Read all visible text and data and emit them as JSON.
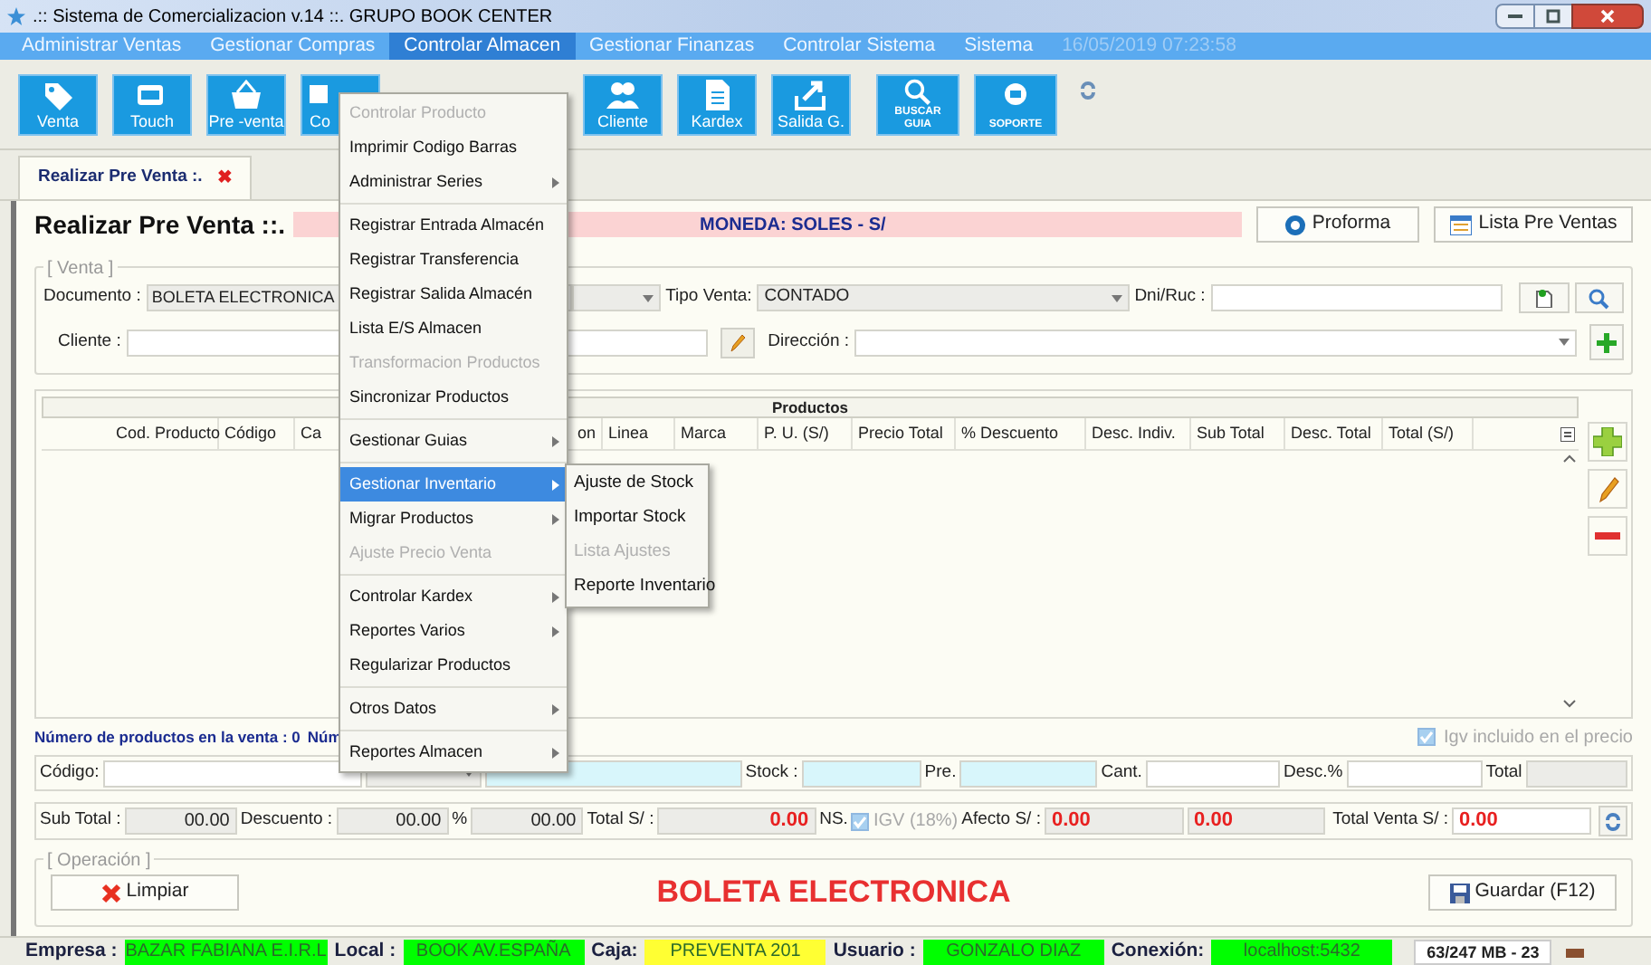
{
  "window": {
    "title": ".:: Sistema de Comercializacion v.14 ::.  GRUPO BOOK CENTER"
  },
  "menu_bar": {
    "items": [
      {
        "label": "Administrar Ventas",
        "selected": false
      },
      {
        "label": "Gestionar Compras",
        "selected": false
      },
      {
        "label": "Controlar Almacen",
        "selected": true
      },
      {
        "label": "Gestionar Finanzas",
        "selected": false
      },
      {
        "label": "Controlar Sistema",
        "selected": false
      },
      {
        "label": "Sistema",
        "selected": false
      }
    ],
    "datetime": "16/05/2019 07:23:58"
  },
  "toolbar": [
    {
      "label": "Venta",
      "kind": "tile"
    },
    {
      "label": "Touch",
      "kind": "tile"
    },
    {
      "label": "Pre -venta",
      "kind": "tile"
    },
    {
      "label": "Co",
      "kind": "tile"
    },
    {
      "label": "Cliente",
      "kind": "tile"
    },
    {
      "label": "Kardex",
      "kind": "tile"
    },
    {
      "label": "Salida G.",
      "kind": "tile"
    },
    {
      "label": "BUSCAR GUIA",
      "kind": "badge"
    },
    {
      "label": "SOPORTE",
      "kind": "badge"
    },
    {
      "kind": "refresh"
    }
  ],
  "tab": {
    "label": "Realizar Pre Venta :.",
    "close": "✖"
  },
  "heading": "Realizar Pre Venta ::.",
  "currency": "MONEDA: SOLES - S/",
  "header_buttons": [
    "Proforma",
    "Lista Pre Ventas"
  ],
  "venta": {
    "legend": "[ Venta ]",
    "documento_label": "Documento :",
    "documento": "BOLETA ELECTRONICA",
    "tipo_label": "Tipo Venta:",
    "tipo": "CONTADO",
    "dni_label": "Dni/Ruc :",
    "cliente_label": "Cliente :",
    "direccion_label": "Dirección :"
  },
  "products": {
    "title": "Productos",
    "columns": [
      "Cod. Producto",
      "Código",
      "Ca",
      "on",
      "Linea",
      "Marca",
      "P. U. (S/)",
      "Precio Total",
      "% Descuento",
      "Desc. Indiv.",
      "Sub Total",
      "Desc. Total",
      "Total (S/)"
    ]
  },
  "count_text": "Número de productos en la venta : 0",
  "count_text_2": "Núm",
  "igv_included": {
    "label": "Igv incluido en el precio",
    "checked": true,
    "disabled": true
  },
  "entry_row": {
    "codigo": "Código:",
    "stock": "Stock :",
    "pre": "Pre.",
    "cant": "Cant.",
    "desc": "Desc.%",
    "total": "Total"
  },
  "totals": {
    "sub_total_label": "Sub Total :",
    "sub_total": "00.00",
    "descuento_label": "Descuento :",
    "descuento": "00.00",
    "percent": "%",
    "descuento_amount": "00.00",
    "total_label": "Total S/ :",
    "total": "0.00",
    "ns": "NS.",
    "igv": {
      "label": "IGV (18%)",
      "checked": true,
      "disabled": true
    },
    "afecto_label": "Afecto S/ :",
    "afecto": "0.00",
    "igv_amount": "0.00",
    "total_venta_label": "Total Venta S/ :",
    "total_venta": "0.00"
  },
  "operacion": {
    "legend": "[ Operación ]",
    "limpiar": "Limpiar",
    "document_type": "BOLETA ELECTRONICA",
    "guardar": "Guardar (F12)"
  },
  "status_bar": [
    {
      "label": "Empresa :",
      "value": "BAZAR FABIANA E.I.R.L",
      "color": "#00ff00"
    },
    {
      "label": "Local :",
      "value": "BOOK AV.ESPAÑA",
      "color": "#00ff00"
    },
    {
      "label": "Caja:",
      "value": "PREVENTA 201",
      "color": "#ffff33"
    },
    {
      "label": "Usuario :",
      "value": "GONZALO DIAZ",
      "color": "#00ff00"
    },
    {
      "label": "Conexión:",
      "value": "localhost:5432",
      "color": "#00ff00"
    }
  ],
  "memory": "63/247 MB - 23",
  "dropdown": {
    "groups": [
      [
        {
          "label": "Controlar Producto",
          "disabled": true,
          "submenu": false,
          "selected": false
        },
        {
          "label": "Imprimir Codigo Barras",
          "disabled": false,
          "submenu": false,
          "selected": false
        },
        {
          "label": "Administrar Series",
          "disabled": false,
          "submenu": true,
          "selected": false
        }
      ],
      [
        {
          "label": "Registrar Entrada Almacén",
          "disabled": false,
          "submenu": false,
          "selected": false
        },
        {
          "label": "Registrar Transferencia",
          "disabled": false,
          "submenu": false,
          "selected": false
        },
        {
          "label": "Registrar Salida Almacén",
          "disabled": false,
          "submenu": false,
          "selected": false
        },
        {
          "label": "Lista E/S Almacen",
          "disabled": false,
          "submenu": false,
          "selected": false
        },
        {
          "label": "Transformacion Productos",
          "disabled": true,
          "submenu": false,
          "selected": false
        },
        {
          "label": "Sincronizar Productos",
          "disabled": false,
          "submenu": false,
          "selected": false
        }
      ],
      [
        {
          "label": "Gestionar Guias",
          "disabled": false,
          "submenu": true,
          "selected": false
        }
      ],
      [
        {
          "label": "Gestionar Inventario",
          "disabled": false,
          "submenu": true,
          "selected": true
        },
        {
          "label": "Migrar Productos",
          "disabled": false,
          "submenu": true,
          "selected": false
        },
        {
          "label": "Ajuste Precio Venta",
          "disabled": true,
          "submenu": false,
          "selected": false
        }
      ],
      [
        {
          "label": "Controlar Kardex",
          "disabled": false,
          "submenu": true,
          "selected": false
        },
        {
          "label": "Reportes Varios",
          "disabled": false,
          "submenu": true,
          "selected": false
        },
        {
          "label": "Regularizar Productos",
          "disabled": false,
          "submenu": false,
          "selected": false
        }
      ],
      [
        {
          "label": "Otros Datos",
          "disabled": false,
          "submenu": true,
          "selected": false
        }
      ],
      [
        {
          "label": "Reportes Almacen",
          "disabled": false,
          "submenu": true,
          "selected": false
        }
      ]
    ]
  },
  "submenu": {
    "items": [
      {
        "label": "Ajuste de Stock",
        "disabled": false
      },
      {
        "label": "Importar Stock",
        "disabled": false
      },
      {
        "label": "Lista Ajustes",
        "disabled": true
      },
      {
        "label": "Reporte Inventario",
        "disabled": false
      }
    ]
  }
}
